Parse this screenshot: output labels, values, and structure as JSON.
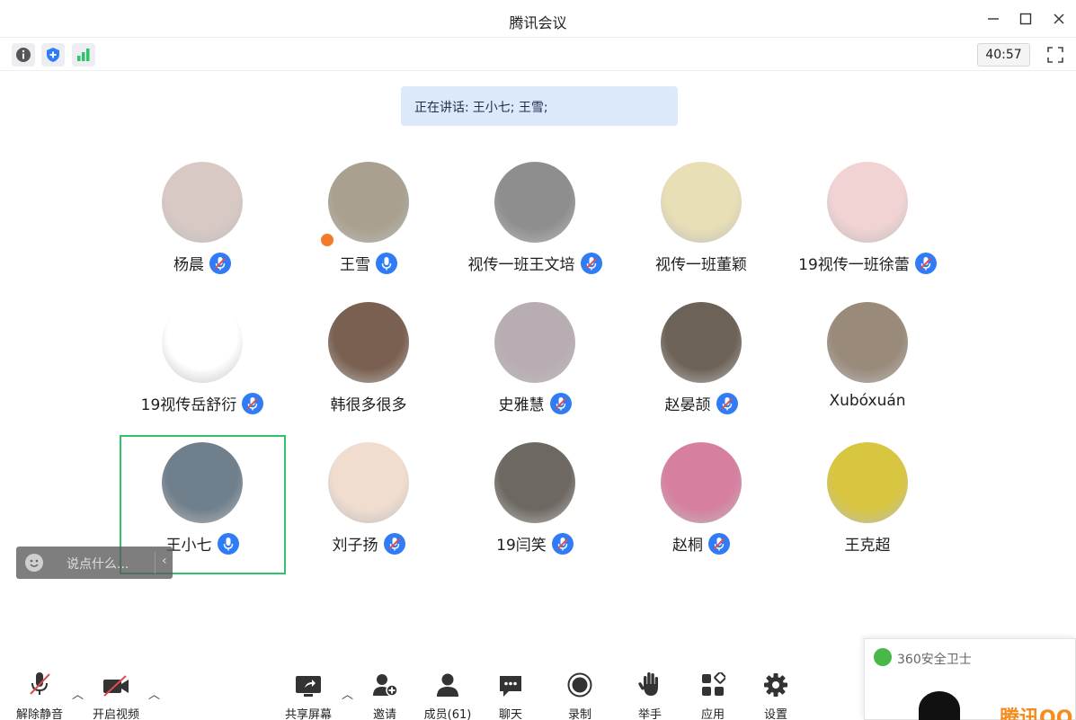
{
  "window": {
    "title": "腾讯会议"
  },
  "toolbar": {
    "timer": "40:57"
  },
  "speaking": {
    "label": "正在讲话:",
    "names": "王小七; 王雪;"
  },
  "participants": [
    {
      "name": "杨晨",
      "mic": "muted",
      "avatar_color": "#d9c9c4"
    },
    {
      "name": "王雪",
      "mic": "active",
      "avatar_color": "#a9a08f",
      "host": true
    },
    {
      "name": "视传一班王文培",
      "mic": "muted",
      "avatar_color": "#8e8e8e"
    },
    {
      "name": "视传一班董颖",
      "mic": "none",
      "avatar_color": "#e9dfb6"
    },
    {
      "name": "19视传一班徐蕾",
      "mic": "muted",
      "avatar_color": "#f1d3d3"
    },
    {
      "name": "19视传岳舒衍",
      "mic": "muted",
      "avatar_color": "#ffffff"
    },
    {
      "name": "韩很多很多",
      "mic": "none",
      "avatar_color": "#7a6050"
    },
    {
      "name": "史雅慧",
      "mic": "muted",
      "avatar_color": "#b9adb4"
    },
    {
      "name": "赵晏颉",
      "mic": "muted",
      "avatar_color": "#6d6257"
    },
    {
      "name": "Xubóxuán",
      "mic": "none",
      "avatar_color": "#9a8a7a"
    },
    {
      "name": "王小七",
      "mic": "active",
      "avatar_color": "#6f7f8c"
    },
    {
      "name": "刘子扬",
      "mic": "muted",
      "avatar_color": "#f0ddd0"
    },
    {
      "name": "19闫笑",
      "mic": "muted",
      "avatar_color": "#6e6862"
    },
    {
      "name": "赵桐",
      "mic": "muted",
      "avatar_color": "#d67fa0"
    },
    {
      "name": "王克超",
      "mic": "none",
      "avatar_color": "#d8c640"
    }
  ],
  "chat_input": {
    "placeholder": "说点什么..."
  },
  "bottombar": {
    "unmute": "解除静音",
    "start_video": "开启视频",
    "share_screen": "共享屏幕",
    "invite": "邀请",
    "members": "成员(61)",
    "chat": "聊天",
    "record": "录制",
    "raise_hand": "举手",
    "apps": "应用",
    "settings": "设置"
  },
  "popup": {
    "title": "360安全卫士",
    "brand": "腾讯QQ"
  },
  "colors": {
    "accent": "#2f7cf6",
    "active_speaker_border": "#2ec36b",
    "speaking_bg": "#dce9fb"
  }
}
